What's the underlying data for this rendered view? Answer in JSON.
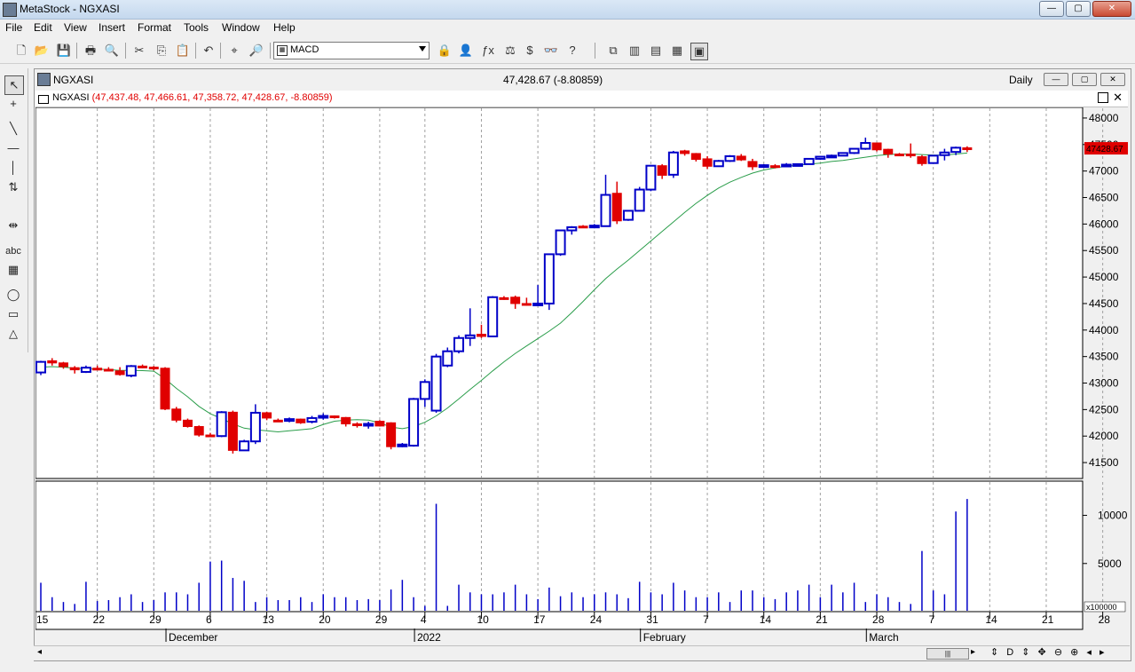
{
  "app": {
    "title": "MetaStock - NGXASI"
  },
  "window_buttons": {
    "minimize": "—",
    "maximize": "▢",
    "close": "✕"
  },
  "menu": [
    "File",
    "Edit",
    "View",
    "Insert",
    "Format",
    "Tools",
    "Window",
    "Help"
  ],
  "toolbar": {
    "indicator_combo": "MACD",
    "buttons": [
      {
        "name": "new-icon",
        "glyph": "🗋"
      },
      {
        "name": "open-icon",
        "glyph": "📂"
      },
      {
        "name": "save-icon",
        "glyph": "💾"
      },
      {
        "name": "print-icon",
        "glyph": "🖶"
      },
      {
        "name": "print-preview-icon",
        "glyph": "🔍"
      },
      {
        "name": "cut-icon",
        "glyph": "✂"
      },
      {
        "name": "copy-icon",
        "glyph": "⎘"
      },
      {
        "name": "paste-icon",
        "glyph": "📋"
      },
      {
        "name": "undo-icon",
        "glyph": "↶"
      },
      {
        "name": "crosshair-icon",
        "glyph": "⌖"
      },
      {
        "name": "zoom-icon",
        "glyph": "🔎"
      },
      {
        "name": "lock-icon",
        "glyph": "🔒"
      },
      {
        "name": "wizard-icon",
        "glyph": "👤"
      },
      {
        "name": "formula-icon",
        "glyph": "ƒx"
      },
      {
        "name": "system-tester-icon",
        "glyph": "⚖"
      },
      {
        "name": "dollar-icon",
        "glyph": "$"
      },
      {
        "name": "binoculars-icon",
        "glyph": "👓"
      },
      {
        "name": "help-pointer-icon",
        "glyph": "?"
      },
      {
        "name": "layout-cascade-icon",
        "glyph": "⧉"
      },
      {
        "name": "layout-vertical-icon",
        "glyph": "▥"
      },
      {
        "name": "layout-horizontal-icon",
        "glyph": "▤"
      },
      {
        "name": "layout-grid-icon",
        "glyph": "▦"
      },
      {
        "name": "layout-active-icon",
        "glyph": "▣"
      }
    ]
  },
  "left_tools": [
    {
      "name": "pointer-tool-icon",
      "glyph": "↖"
    },
    {
      "name": "crosshair-tool-icon",
      "glyph": "+"
    },
    {
      "name": "trendline-tool-icon",
      "glyph": "╲"
    },
    {
      "name": "horizontal-line-tool-icon",
      "glyph": "—"
    },
    {
      "name": "vertical-line-tool-icon",
      "glyph": "│"
    },
    {
      "name": "split-tool-icon",
      "glyph": "⇅"
    },
    {
      "name": "spacing-tool-icon",
      "glyph": "⇹"
    },
    {
      "name": "text-tool-icon",
      "glyph": "abc"
    },
    {
      "name": "grid-tool-icon",
      "glyph": "▦"
    },
    {
      "name": "ellipse-tool-icon",
      "glyph": "◯"
    },
    {
      "name": "rectangle-tool-icon",
      "glyph": "▭"
    },
    {
      "name": "triangle-tool-icon",
      "glyph": "△"
    }
  ],
  "chart_window": {
    "name": "NGXASI",
    "center_value": "47,428.67 (-8.80859)",
    "period": "Daily",
    "header_name": "NGXASI",
    "header_values": "(47,437.48, 47,466.61, 47,358.72, 47,428.67, -8.80859)"
  },
  "scroll": {
    "left_arrow": "◂",
    "thumb": "|||",
    "right_arrow": "▸",
    "controls": "⇕ D ⇕ ✥ ⊖ ⊕ ◂ ▸"
  },
  "chart_data": [
    {
      "type": "candlestick",
      "series_name": "NGXASI",
      "period": "Daily",
      "last_price_label": "47428.67",
      "ylim": [
        41200,
        48200
      ],
      "y_ticks": [
        41500,
        42000,
        42500,
        43000,
        43500,
        44000,
        44500,
        45000,
        45500,
        46000,
        46500,
        47000,
        47500,
        48000
      ],
      "x_day_labels": [
        "15",
        "22",
        "29",
        "6",
        "13",
        "20",
        "29",
        "4",
        "10",
        "17",
        "24",
        "31",
        "7",
        "14",
        "21",
        "28",
        "7",
        "14",
        "21",
        "28"
      ],
      "x_month_labels": [
        "December",
        "2022",
        "February",
        "March"
      ],
      "colors": {
        "up": "#0000c8",
        "down": "#e00000",
        "ma": "#2a9d4a"
      },
      "ohlc": [
        [
          43200,
          43420,
          43150,
          43400
        ],
        [
          43420,
          43470,
          43330,
          43380
        ],
        [
          43380,
          43400,
          43270,
          43310
        ],
        [
          43290,
          43320,
          43180,
          43250
        ],
        [
          43210,
          43330,
          43190,
          43290
        ],
        [
          43280,
          43330,
          43240,
          43260
        ],
        [
          43260,
          43300,
          43220,
          43240
        ],
        [
          43230,
          43300,
          43140,
          43160
        ],
        [
          43140,
          43340,
          43110,
          43320
        ],
        [
          43320,
          43350,
          43280,
          43300
        ],
        [
          43300,
          43320,
          43240,
          43280
        ],
        [
          43280,
          43300,
          42490,
          42510
        ],
        [
          42510,
          42550,
          42260,
          42300
        ],
        [
          42300,
          42330,
          42160,
          42180
        ],
        [
          42180,
          42200,
          41990,
          42020
        ],
        [
          42020,
          42060,
          41980,
          42000
        ],
        [
          42000,
          42470,
          41980,
          42450
        ],
        [
          42450,
          42480,
          41670,
          41730
        ],
        [
          41730,
          41930,
          41730,
          41900
        ],
        [
          41900,
          42600,
          41850,
          42440
        ],
        [
          42440,
          42460,
          42300,
          42340
        ],
        [
          42300,
          42330,
          42270,
          42280
        ],
        [
          42290,
          42350,
          42260,
          42320
        ],
        [
          42320,
          42330,
          42230,
          42250
        ],
        [
          42270,
          42380,
          42240,
          42340
        ],
        [
          42360,
          42430,
          42310,
          42380
        ],
        [
          42380,
          42390,
          42330,
          42350
        ],
        [
          42350,
          42360,
          42180,
          42230
        ],
        [
          42230,
          42260,
          42160,
          42200
        ],
        [
          42200,
          42270,
          42140,
          42230
        ],
        [
          42280,
          42300,
          42180,
          42190
        ],
        [
          42250,
          42260,
          41750,
          41800
        ],
        [
          41820,
          41870,
          41790,
          41840
        ],
        [
          41820,
          42720,
          41800,
          42700
        ],
        [
          42700,
          43070,
          42550,
          43020
        ],
        [
          42480,
          43550,
          42440,
          43500
        ],
        [
          43330,
          43670,
          43300,
          43600
        ],
        [
          43600,
          43900,
          43560,
          43850
        ],
        [
          43850,
          44410,
          43700,
          43900
        ],
        [
          43920,
          44100,
          43850,
          43880
        ],
        [
          43880,
          44640,
          43870,
          44620
        ],
        [
          44610,
          44640,
          44570,
          44590
        ],
        [
          44620,
          44650,
          44400,
          44500
        ],
        [
          44500,
          44610,
          44460,
          44480
        ],
        [
          44480,
          44850,
          44470,
          44500
        ],
        [
          44500,
          45440,
          44380,
          45430
        ],
        [
          45430,
          45880,
          45400,
          45880
        ],
        [
          45880,
          45960,
          45800,
          45940
        ],
        [
          45960,
          45980,
          45930,
          45950
        ],
        [
          45950,
          46000,
          45920,
          45970
        ],
        [
          45960,
          46930,
          45950,
          46550
        ],
        [
          46580,
          46800,
          46000,
          46060
        ],
        [
          46080,
          46250,
          46060,
          46250
        ],
        [
          46250,
          46700,
          46240,
          46650
        ],
        [
          46650,
          47110,
          46620,
          47100
        ],
        [
          47100,
          47130,
          46850,
          46920
        ],
        [
          46930,
          47380,
          46870,
          47350
        ],
        [
          47380,
          47400,
          47290,
          47330
        ],
        [
          47330,
          47340,
          47180,
          47220
        ],
        [
          47230,
          47280,
          47040,
          47090
        ],
        [
          47090,
          47210,
          47080,
          47190
        ],
        [
          47190,
          47300,
          47170,
          47280
        ],
        [
          47280,
          47320,
          47190,
          47210
        ],
        [
          47180,
          47230,
          47020,
          47080
        ],
        [
          47080,
          47130,
          47060,
          47110
        ],
        [
          47100,
          47130,
          47050,
          47080
        ],
        [
          47090,
          47150,
          47080,
          47120
        ],
        [
          47120,
          47140,
          47110,
          47130
        ],
        [
          47130,
          47240,
          47120,
          47230
        ],
        [
          47230,
          47280,
          47210,
          47270
        ],
        [
          47260,
          47310,
          47250,
          47290
        ],
        [
          47290,
          47350,
          47280,
          47340
        ],
        [
          47340,
          47430,
          47320,
          47420
        ],
        [
          47420,
          47630,
          47400,
          47530
        ],
        [
          47530,
          47530,
          47370,
          47400
        ],
        [
          47410,
          47420,
          47250,
          47320
        ],
        [
          47320,
          47340,
          47290,
          47310
        ],
        [
          47320,
          47520,
          47250,
          47300
        ],
        [
          47270,
          47300,
          47100,
          47140
        ],
        [
          47150,
          47300,
          47140,
          47290
        ],
        [
          47300,
          47420,
          47200,
          47350
        ],
        [
          47360,
          47460,
          47300,
          47440
        ],
        [
          47437.48,
          47466.61,
          47358.72,
          47428.67
        ]
      ],
      "ma": [
        43300,
        43310,
        43300,
        43280,
        43270,
        43262,
        43255,
        43240,
        43240,
        43235,
        43225,
        43080,
        42900,
        42740,
        42560,
        42420,
        42330,
        42230,
        42150,
        42120,
        42100,
        42080,
        42100,
        42120,
        42140,
        42220,
        42280,
        42300,
        42310,
        42300,
        42250,
        42170,
        42140,
        42180,
        42260,
        42380,
        42530,
        42700,
        42880,
        43050,
        43230,
        43400,
        43560,
        43700,
        43840,
        43980,
        44130,
        44330,
        44540,
        44760,
        44970,
        45150,
        45320,
        45500,
        45680,
        45860,
        46040,
        46220,
        46390,
        46540,
        46680,
        46790,
        46880,
        46960,
        47020,
        47060,
        47090,
        47110,
        47130,
        47150,
        47180,
        47200,
        47230,
        47260,
        47290,
        47310,
        47320,
        47320,
        47310,
        47300,
        47300,
        47320,
        47340
      ]
    },
    {
      "type": "bar",
      "series_name": "Volume",
      "unit_label": "x100000",
      "ylim": [
        0,
        13000
      ],
      "y_ticks": [
        5000,
        10000
      ],
      "values": [
        3000,
        1500,
        1000,
        800,
        3100,
        1100,
        1200,
        1500,
        1800,
        1000,
        1200,
        2000,
        2000,
        1800,
        3000,
        5200,
        5300,
        3500,
        3200,
        1000,
        1500,
        1200,
        1200,
        1500,
        1000,
        1800,
        1500,
        1500,
        1200,
        1300,
        1200,
        2300,
        3300,
        1500,
        600,
        11200,
        600,
        2800,
        2000,
        1800,
        1800,
        2000,
        2800,
        1800,
        1300,
        2500,
        1600,
        2000,
        1500,
        1800,
        2000,
        1800,
        1400,
        3100,
        2000,
        1800,
        3000,
        2200,
        1500,
        1500,
        2000,
        1000,
        2200,
        2200,
        1500,
        1300,
        2000,
        2200,
        2800,
        1500,
        2800,
        2000,
        3000,
        1000,
        1800,
        1500,
        1000,
        800,
        6300,
        2200,
        1800,
        10400,
        11700
      ]
    }
  ]
}
